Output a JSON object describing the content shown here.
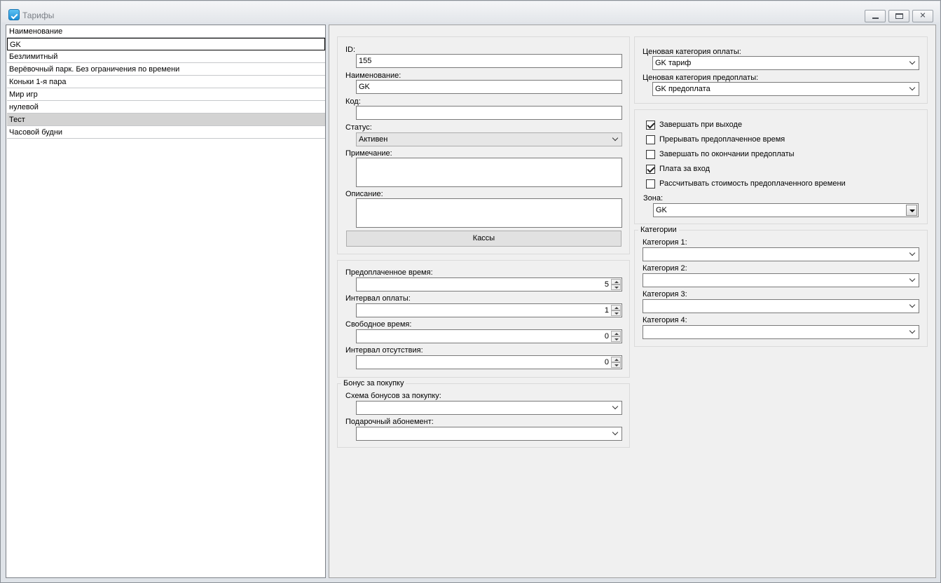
{
  "window": {
    "title": "Тарифы"
  },
  "list": {
    "header": "Наименование",
    "items": [
      "GK",
      "Безлимитный",
      "Верёвочный парк. Без ограничения по времени",
      "Коньки 1-я пара",
      "Мир игр",
      "нулевой",
      "Тест",
      "Часовой будни"
    ]
  },
  "form": {
    "id_label": "ID:",
    "id_value": "155",
    "name_label": "Наименование:",
    "name_value": "GK",
    "code_label": "Код:",
    "code_value": "",
    "status_label": "Статус:",
    "status_value": "Активен",
    "note_label": "Примечание:",
    "description_label": "Описание:",
    "cash_button": "Кассы"
  },
  "time": {
    "prepaid_label": "Предоплаченное время:",
    "prepaid_value": "5",
    "pay_interval_label": "Интервал оплаты:",
    "pay_interval_value": "1",
    "free_time_label": "Свободное время:",
    "free_time_value": "0",
    "absence_label": "Интервал отсутствия:",
    "absence_value": "0"
  },
  "bonus": {
    "title": "Бонус за покупку",
    "scheme_label": "Схема бонусов за покупку:",
    "scheme_value": "",
    "gift_label": "Подарочный абонемент:",
    "gift_value": ""
  },
  "price": {
    "pay_category_label": "Ценовая категория оплаты:",
    "pay_category_value": "GK тариф",
    "prepay_category_label": "Ценовая категория предоплаты:",
    "prepay_category_value": "GK  предоплата"
  },
  "options": {
    "checkboxes": [
      {
        "label": "Завершать при выходе",
        "checked": true
      },
      {
        "label": "Прерывать предоплаченное время",
        "checked": false
      },
      {
        "label": "Завершать по окончании предоплаты",
        "checked": false
      },
      {
        "label": "Плата за вход",
        "checked": true
      },
      {
        "label": "Рассчитывать стоимость предоплаченного времени",
        "checked": false
      }
    ],
    "zone_label": "Зона:",
    "zone_value": "GK"
  },
  "categories": {
    "title": "Категории",
    "labels": [
      "Категория 1:",
      "Категория 2:",
      "Категория 3:",
      "Категория 4:"
    ],
    "values": [
      "",
      "",
      "",
      ""
    ]
  }
}
